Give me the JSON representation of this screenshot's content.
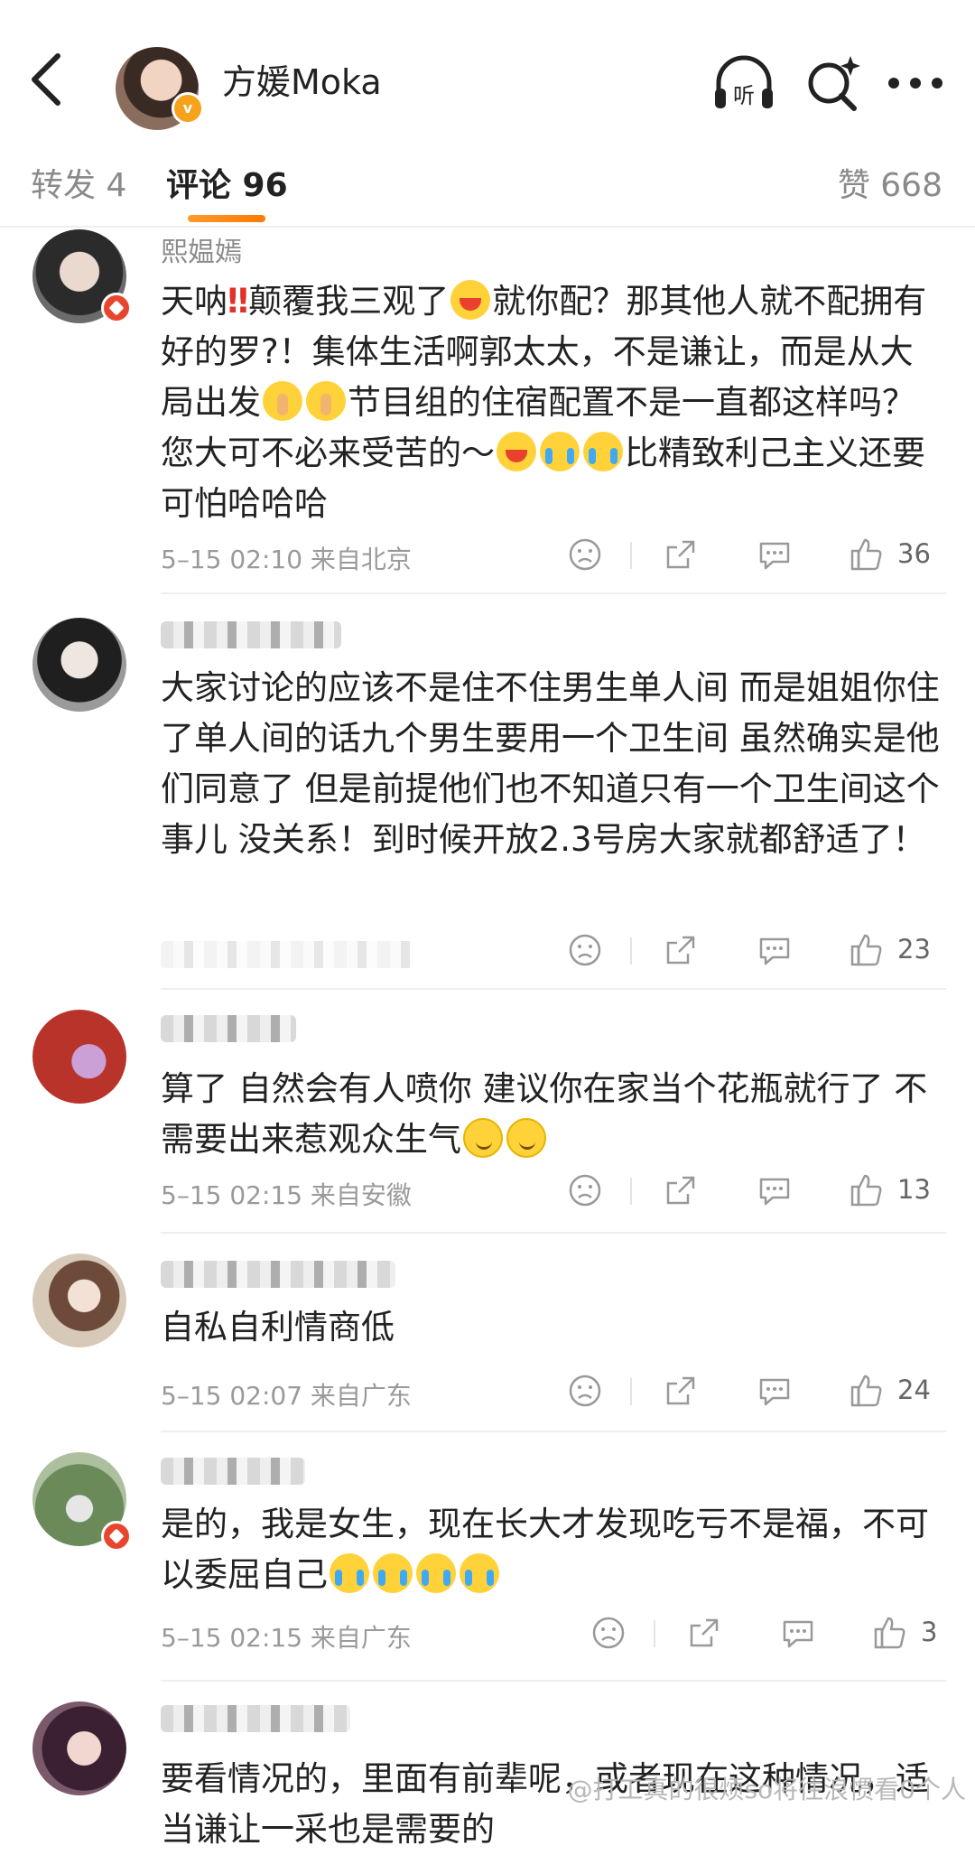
{
  "header": {
    "title": "方媛Moka",
    "back_icon": "chevron-left-icon",
    "listen_label": "听",
    "badge": "v"
  },
  "tabs": {
    "repost": "转发 4",
    "comments": "评论 96",
    "likes": "赞 668"
  },
  "comments": [
    {
      "username": "熙媪嫣",
      "text_parts": [
        "天呐",
        "‼️",
        "颠覆我三观了",
        "[laugh]",
        "就你配？那其他人就不配拥有好的罗?！集体生活啊郭太太，不是谦让，而是从大局出发",
        "[shush]",
        "[shush]",
        "节目组的住宿配置不是一直都这样吗？您大可不必来受苦的～",
        "[laugh]",
        "[cry]",
        "[cry]",
        "比精致利己主义还要可怕哈哈哈"
      ],
      "t1": "天呐",
      "t2": "颠覆我三观了",
      "t3": "就你配？那其他人就不配拥有好的罗?！集体生活啊郭太太，不是谦让，而是从大局出发",
      "t4": "节目组的住宿配置不是一直都这样吗？您大可不必来受苦的～",
      "t5": "比精致利己主义还要可怕哈哈哈",
      "bang": "‼",
      "meta": "5–15 02:10  来自北京",
      "likes": "36"
    },
    {
      "username": "",
      "text": "大家讨论的应该不是住不住男生单人间 而是姐姐你住了单人间的话九个男生要用一个卫生间 虽然确实是他们同意了 但是前提他们也不知道只有一个卫生间这个事儿 没关系！到时候开放2.3号房大家就都舒适了！",
      "meta": "",
      "likes": "23"
    },
    {
      "username": "",
      "text": "算了 自然会有人喷你 建议你在家当个花瓶就行了 不需要出来惹观众生气",
      "meta": "5–15 02:15  来自安徽",
      "likes": "13"
    },
    {
      "username": "",
      "text": "自私自利情商低",
      "meta": "5–15 02:07  来自广东",
      "likes": "24"
    },
    {
      "username": "",
      "text": "是的，我是女生，现在长大才发现吃亏不是福，不可以委屈自己",
      "meta": "5–15 02:15  来自广东",
      "likes": "3"
    },
    {
      "username": "",
      "text": "要看情况的，里面有前辈呢，或者现在这种情况，适当谦让一采也是需要的"
    }
  ],
  "watermark": "@打工真的很烦so将往浪惯看0个人",
  "colors": {
    "accent": "#ff8200",
    "badge_orange": "#f6a21a",
    "badge_red": "#e8452f"
  }
}
